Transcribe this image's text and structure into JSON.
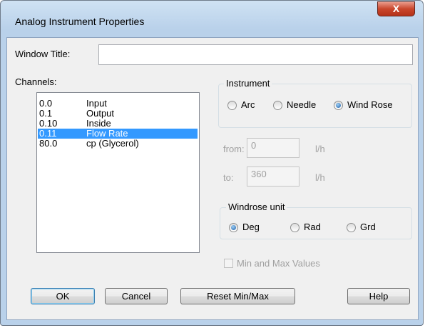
{
  "window": {
    "title": "Analog Instrument Properties",
    "close_glyph": "X"
  },
  "window_title_field": {
    "label": "Window Title:",
    "value": ""
  },
  "channels": {
    "label": "Channels:",
    "items": [
      {
        "id": "0.0",
        "name": "Input",
        "selected": false
      },
      {
        "id": "0.1",
        "name": "Output",
        "selected": false
      },
      {
        "id": "0.10",
        "name": "Inside",
        "selected": false
      },
      {
        "id": "0.11",
        "name": "Flow Rate",
        "selected": true
      },
      {
        "id": "80.0",
        "name": "cp (Glycerol)",
        "selected": false
      }
    ]
  },
  "instrument": {
    "label": "Instrument",
    "options": [
      "Arc",
      "Needle",
      "Wind Rose"
    ],
    "selected": "Wind Rose"
  },
  "range": {
    "from_label": "from:",
    "from_value": "0",
    "from_unit": "l/h",
    "to_label": "to:",
    "to_value": "360",
    "to_unit": "l/h"
  },
  "windrose_unit": {
    "label": "Windrose unit",
    "options": [
      "Deg",
      "Rad",
      "Grd"
    ],
    "selected": "Deg"
  },
  "minmax": {
    "label": "Min and Max Values",
    "checked": false,
    "enabled": false
  },
  "buttons": {
    "ok": "OK",
    "cancel": "Cancel",
    "reset": "Reset Min/Max",
    "help": "Help"
  },
  "colors": {
    "selection": "#3399ff",
    "close_button": "#c9462c",
    "disabled_text": "#a0a0a0"
  }
}
